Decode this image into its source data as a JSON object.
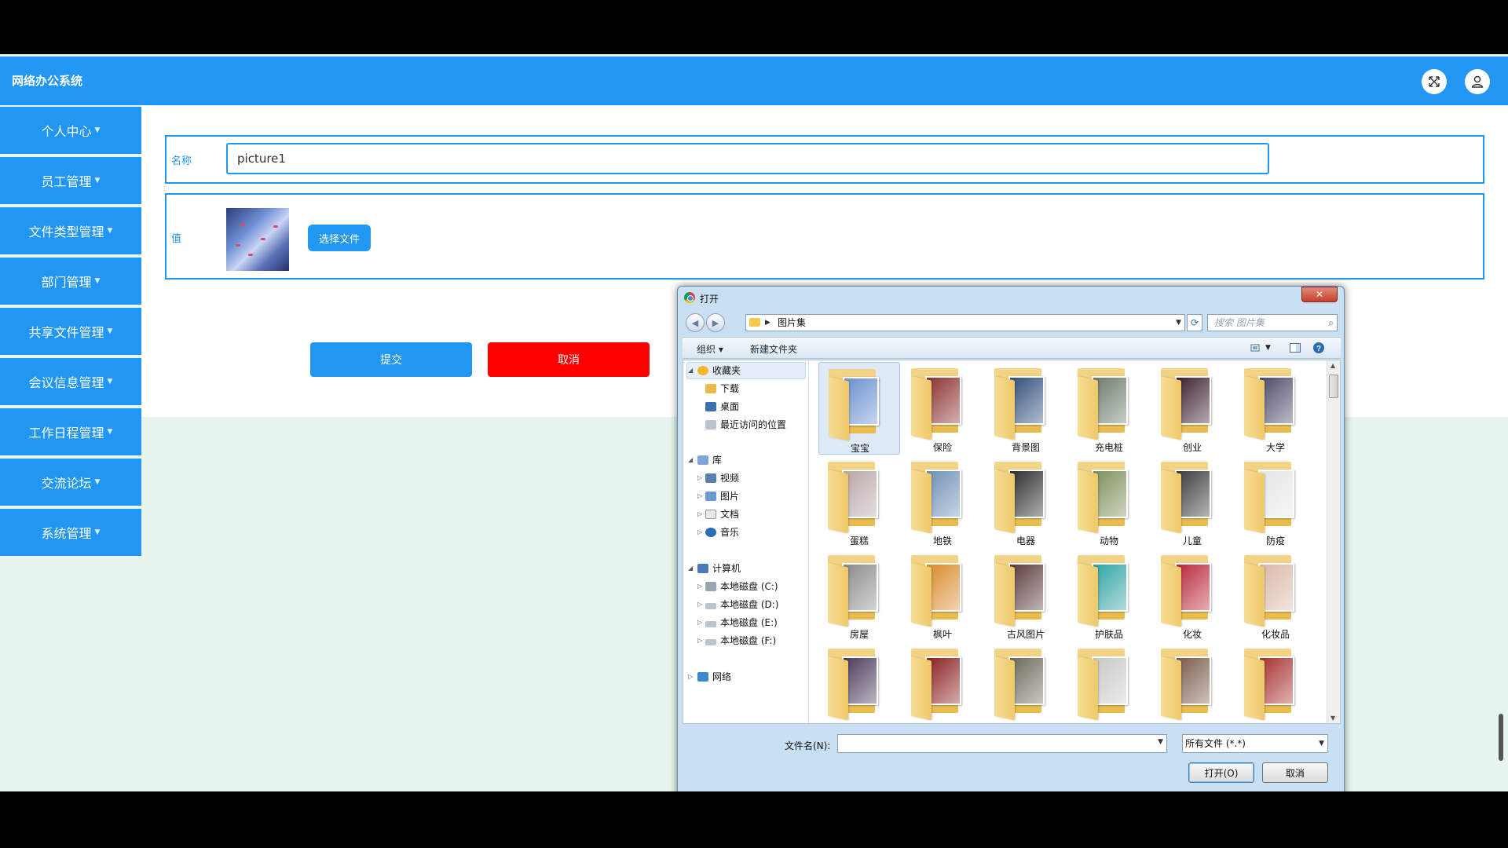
{
  "app": {
    "title": "网络办公系统"
  },
  "sidebar": {
    "items": [
      {
        "label": "个人中心"
      },
      {
        "label": "员工管理"
      },
      {
        "label": "文件类型管理"
      },
      {
        "label": "部门管理"
      },
      {
        "label": "共享文件管理"
      },
      {
        "label": "会议信息管理"
      },
      {
        "label": "工作日程管理"
      },
      {
        "label": "交流论坛"
      },
      {
        "label": "系统管理"
      }
    ]
  },
  "form": {
    "name_label": "名称",
    "name_value": "picture1",
    "value_label": "值",
    "choose_file": "选择文件",
    "submit": "提交",
    "cancel": "取消"
  },
  "dialog": {
    "title": "打开",
    "close": "✕",
    "path": "图片集",
    "search_placeholder": "搜索 图片集",
    "toolbar": {
      "organize": "组织 ▾",
      "new_folder": "新建文件夹"
    },
    "nav": {
      "favorites": "收藏夹",
      "downloads": "下载",
      "desktop": "桌面",
      "recent": "最近访问的位置",
      "libraries": "库",
      "videos": "视频",
      "pictures": "图片",
      "documents": "文档",
      "music": "音乐",
      "computer": "计算机",
      "disk_c": "本地磁盘 (C:)",
      "disk_d": "本地磁盘 (D:)",
      "disk_e": "本地磁盘 (E:)",
      "disk_f": "本地磁盘 (F:)",
      "network": "网络"
    },
    "folders": [
      {
        "name": "宝宝",
        "color": "#6a8fd1"
      },
      {
        "name": "保险",
        "color": "#8b2f2f"
      },
      {
        "name": "背景图",
        "color": "#2e4e7a"
      },
      {
        "name": "充电桩",
        "color": "#6b7a6a"
      },
      {
        "name": "创业",
        "color": "#3b1f2d"
      },
      {
        "name": "大学",
        "color": "#4a4a6a"
      },
      {
        "name": "蛋糕",
        "color": "#b8a6a6"
      },
      {
        "name": "地铁",
        "color": "#6d8fb5"
      },
      {
        "name": "电器",
        "color": "#2b2b2b"
      },
      {
        "name": "动物",
        "color": "#7d8f5a"
      },
      {
        "name": "儿童",
        "color": "#3a3a3a"
      },
      {
        "name": "防疫",
        "color": "#e6e6e6"
      },
      {
        "name": "房屋",
        "color": "#8a8a8a"
      },
      {
        "name": "枫叶",
        "color": "#d98a2b"
      },
      {
        "name": "古风图片",
        "color": "#5a3a3a"
      },
      {
        "name": "护肤品",
        "color": "#2ea3a3"
      },
      {
        "name": "化妆",
        "color": "#b8283a"
      },
      {
        "name": "化妆品",
        "color": "#d9b8a6"
      },
      {
        "name": "",
        "color": "#4a3a5a"
      },
      {
        "name": "",
        "color": "#8a2020"
      },
      {
        "name": "",
        "color": "#6a6a5a"
      },
      {
        "name": "",
        "color": "#c8c8c8"
      },
      {
        "name": "",
        "color": "#7a5a4a"
      },
      {
        "name": "",
        "color": "#a83030"
      }
    ],
    "filename_label": "文件名(N):",
    "filename_value": "",
    "filetype": "所有文件 (*.*)",
    "open": "打开(O)",
    "cancel": "取消"
  }
}
